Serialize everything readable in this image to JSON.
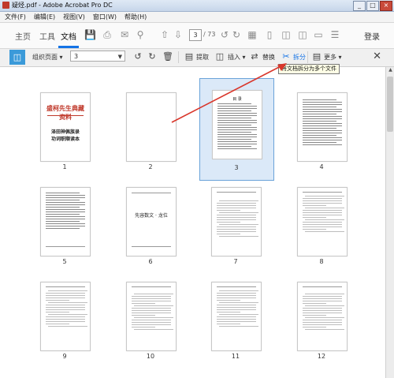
{
  "window": {
    "title": "疑烃.pdf - Adobe Acrobat Pro DC",
    "minimize": "_",
    "maximize": "□",
    "close": "×"
  },
  "menu": [
    "文件(F)",
    "编辑(E)",
    "视图(V)",
    "窗口(W)",
    "帮助(H)"
  ],
  "topnav": {
    "tabs": [
      "主页",
      "工具",
      "文档"
    ],
    "active_tab": "文档",
    "page_current": "3",
    "page_total": "/ 73",
    "signin": "登录"
  },
  "toolbar": {
    "organize_label": "组织页面",
    "page_select_value": "3",
    "extract": "提取",
    "insert": "插入",
    "replace": "替换",
    "split": "拆分",
    "more": "更多"
  },
  "tooltip": "将文档拆分为多个文件",
  "cover": {
    "title": "盛柯先生典藏资料",
    "line1": "泽田神佩族录",
    "line2": "功词职顺读本"
  },
  "page6_text": "先容数文 · 龙位",
  "thumbnails": [
    {
      "num": "1"
    },
    {
      "num": "2"
    },
    {
      "num": "3"
    },
    {
      "num": "4"
    },
    {
      "num": "5"
    },
    {
      "num": "6"
    },
    {
      "num": "7"
    },
    {
      "num": "8"
    },
    {
      "num": "9"
    },
    {
      "num": "10"
    },
    {
      "num": "11"
    },
    {
      "num": "12"
    }
  ],
  "selected_page": "3",
  "colors": {
    "accent": "#1473e6",
    "arrow": "#d9362b",
    "selection": "#dbe9f8",
    "cover_red": "#c0392b"
  },
  "icons": {
    "save": "save-icon",
    "print": "print-icon",
    "mail": "mail-icon",
    "search": "search-icon",
    "up": "arrow-up-icon",
    "down": "arrow-down-icon",
    "rotate_left": "rotate-left-icon",
    "rotate_right": "rotate-right-icon",
    "delete": "trash-icon",
    "scissors": "scissors-icon"
  }
}
